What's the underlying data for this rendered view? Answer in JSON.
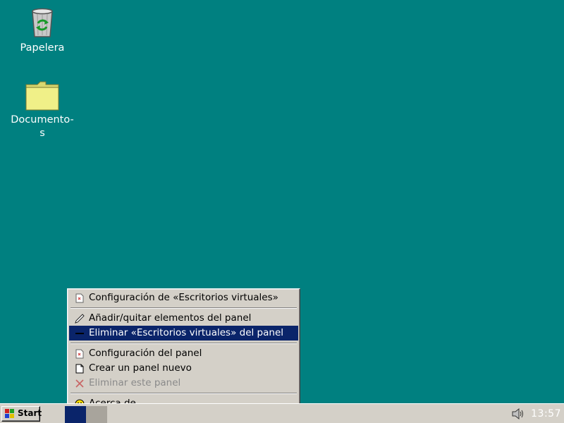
{
  "desktop": {
    "icons": [
      {
        "label": "Papelera",
        "icon": "recycle-bin-icon"
      },
      {
        "label": "Documento-\ns",
        "icon": "folder-icon"
      }
    ],
    "background_color": "#008080"
  },
  "context_menu": {
    "items": [
      {
        "label": "Configuración de «Escritorios virtuales»",
        "icon": "properties-icon",
        "state": "normal"
      },
      {
        "label": "Añadir/quitar elementos del panel",
        "icon": "pencil-icon",
        "state": "normal"
      },
      {
        "label": "Eliminar «Escritorios virtuales» del panel",
        "icon": "minus-icon",
        "state": "selected"
      },
      {
        "label": "Configuración del panel",
        "icon": "properties-icon",
        "state": "normal"
      },
      {
        "label": "Crear un panel nuevo",
        "icon": "new-document-icon",
        "state": "normal"
      },
      {
        "label": "Eliminar este panel",
        "icon": "red-x-icon",
        "state": "disabled"
      },
      {
        "label": "Acerca de",
        "icon": "smiley-icon",
        "state": "normal"
      }
    ],
    "selection_color": "#0a246a"
  },
  "taskbar": {
    "start_label": "Start",
    "clock": "13:57",
    "workspaces": [
      "active",
      "inactive"
    ],
    "volume_icon": "speaker-icon"
  }
}
